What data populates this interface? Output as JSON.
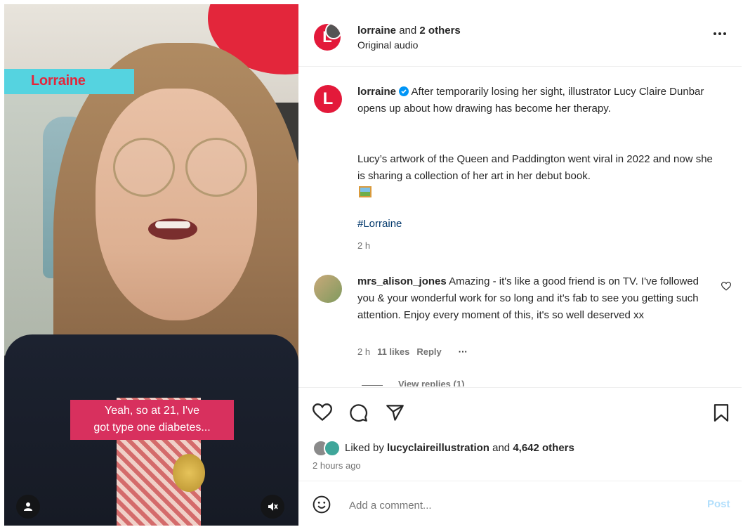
{
  "video": {
    "logo_text": "Lorraine",
    "caption_line1": "Yeah, so at 21, I've",
    "caption_line2": "got type one diabetes...",
    "user_icon": "person-icon",
    "mute_icon": "muted-speaker-icon"
  },
  "header": {
    "user": "lorraine",
    "and_text": " and ",
    "others": "2 others",
    "audio": "Original audio",
    "more_icon": "more-options-icon"
  },
  "post": {
    "username": "lorraine",
    "verified_icon": "verified-badge-icon",
    "caption_p1": "After temporarily losing her sight, illustrator Lucy Claire Dunbar opens up about how drawing has become her therapy.",
    "caption_p2": "Lucy’s artwork of the Queen and Paddington went viral in 2022 and now she is sharing a collection of her art in her debut book.",
    "emoji_icon": "framed-picture-emoji-icon",
    "hashtag": "#Lorraine",
    "time": "2 h"
  },
  "comment": {
    "username": "mrs_alison_jones",
    "text": "Amazing - it's like a good friend is on TV. I've followed you & your wonderful work for so long and it's fab to see you getting such attention. Enjoy every moment of this, it's so well deserved xx",
    "time": "2 h",
    "likes": "11 likes",
    "reply": "Reply",
    "more": "···",
    "view_replies": "View replies (1)"
  },
  "actions": {
    "liked_by": "Liked by ",
    "liked_user": "lucyclaireillustration",
    "and_text": " and ",
    "others_count": "4,642 others",
    "time_ago": "2 hours ago"
  },
  "add_comment": {
    "placeholder": "Add a comment...",
    "post_label": "Post"
  },
  "colors": {
    "brand_pink": "#e3193a",
    "link_blue": "#00376b",
    "post_disabled": "#b2dffc"
  }
}
